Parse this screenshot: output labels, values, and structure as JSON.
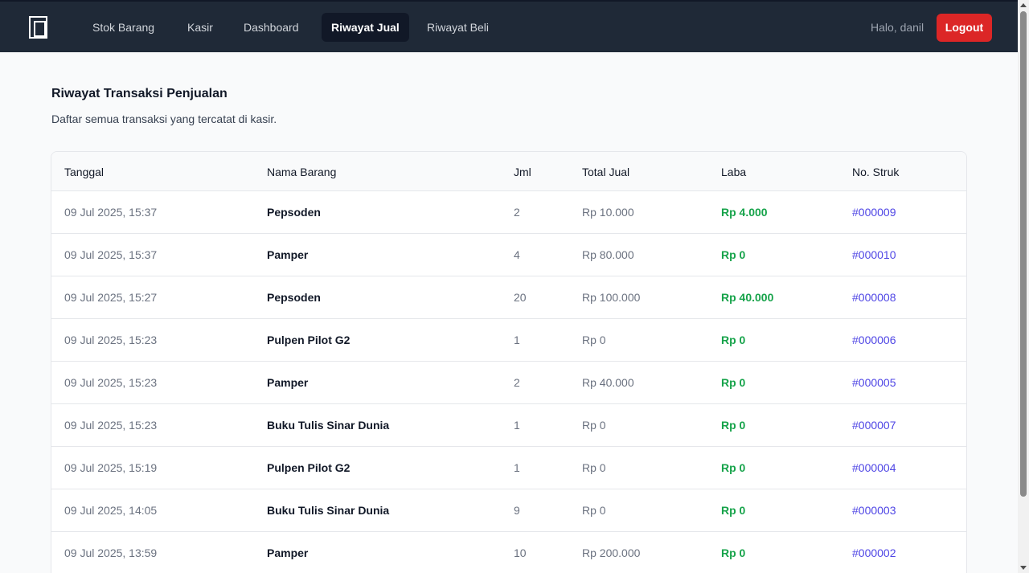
{
  "nav": {
    "items": [
      {
        "label": "Stok Barang"
      },
      {
        "label": "Kasir"
      },
      {
        "label": "Dashboard"
      },
      {
        "label": "Riwayat Jual",
        "active": true
      },
      {
        "label": "Riwayat Beli"
      }
    ],
    "greeting": "Halo, danil",
    "logout_label": "Logout",
    "logo_icon": "door-frame-icon"
  },
  "page": {
    "title": "Riwayat Transaksi Penjualan",
    "subtitle": "Daftar semua transaksi yang tercatat di kasir."
  },
  "table": {
    "headers": {
      "date": "Tanggal",
      "name": "Nama Barang",
      "qty": "Jml",
      "total": "Total Jual",
      "profit": "Laba",
      "receipt": "No. Struk"
    },
    "rows": [
      {
        "date": "09 Jul 2025, 15:37",
        "name": "Pepsoden",
        "qty": "2",
        "total": "Rp 10.000",
        "profit": "Rp 4.000",
        "receipt": "#000009"
      },
      {
        "date": "09 Jul 2025, 15:37",
        "name": "Pamper",
        "qty": "4",
        "total": "Rp 80.000",
        "profit": "Rp 0",
        "receipt": "#000010"
      },
      {
        "date": "09 Jul 2025, 15:27",
        "name": "Pepsoden",
        "qty": "20",
        "total": "Rp 100.000",
        "profit": "Rp 40.000",
        "receipt": "#000008"
      },
      {
        "date": "09 Jul 2025, 15:23",
        "name": "Pulpen Pilot G2",
        "qty": "1",
        "total": "Rp 0",
        "profit": "Rp 0",
        "receipt": "#000006"
      },
      {
        "date": "09 Jul 2025, 15:23",
        "name": "Pamper",
        "qty": "2",
        "total": "Rp 40.000",
        "profit": "Rp 0",
        "receipt": "#000005"
      },
      {
        "date": "09 Jul 2025, 15:23",
        "name": "Buku Tulis Sinar Dunia",
        "qty": "1",
        "total": "Rp 0",
        "profit": "Rp 0",
        "receipt": "#000007"
      },
      {
        "date": "09 Jul 2025, 15:19",
        "name": "Pulpen Pilot G2",
        "qty": "1",
        "total": "Rp 0",
        "profit": "Rp 0",
        "receipt": "#000004"
      },
      {
        "date": "09 Jul 2025, 14:05",
        "name": "Buku Tulis Sinar Dunia",
        "qty": "9",
        "total": "Rp 0",
        "profit": "Rp 0",
        "receipt": "#000003"
      },
      {
        "date": "09 Jul 2025, 13:59",
        "name": "Pamper",
        "qty": "10",
        "total": "Rp 200.000",
        "profit": "Rp 0",
        "receipt": "#000002"
      }
    ]
  },
  "colors": {
    "navbar": "#1f2937",
    "logout": "#dc2626",
    "profit": "#16a34a",
    "receipt_link": "#4f46e5"
  }
}
